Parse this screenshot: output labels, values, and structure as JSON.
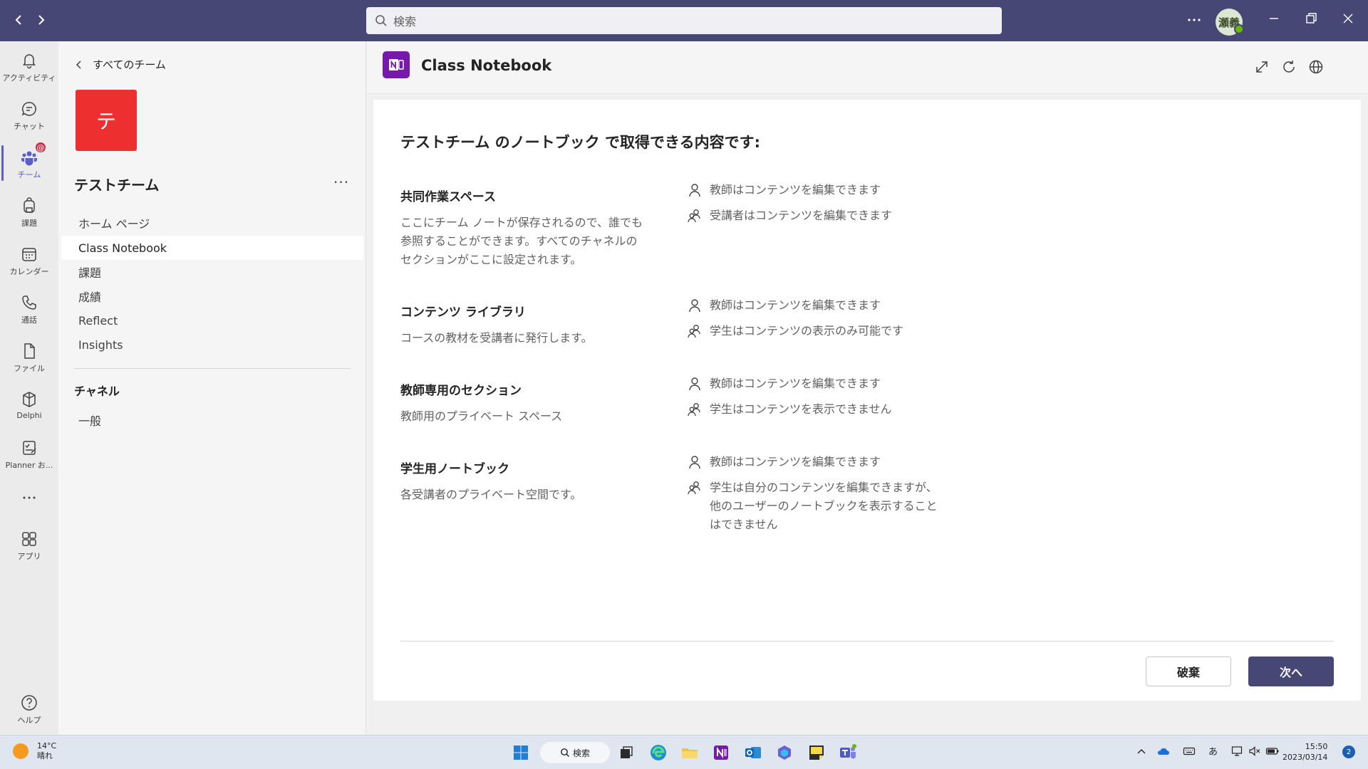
{
  "titlebar": {
    "search_placeholder": "検索",
    "avatar_initials": "瀬義"
  },
  "rail": {
    "items": [
      {
        "label": "アクティビティ",
        "icon": "bell-icon"
      },
      {
        "label": "チャット",
        "icon": "chat-icon"
      },
      {
        "label": "チーム",
        "icon": "teams-icon",
        "active": true,
        "badge": "@"
      },
      {
        "label": "課題",
        "icon": "backpack-icon"
      },
      {
        "label": "カレンダー",
        "icon": "calendar-icon"
      },
      {
        "label": "通話",
        "icon": "phone-icon"
      },
      {
        "label": "ファイル",
        "icon": "file-icon"
      },
      {
        "label": "Delphi",
        "icon": "delphi-icon"
      },
      {
        "label": "Planner お...",
        "icon": "planner-icon"
      },
      {
        "label": "...",
        "icon": "more-icon"
      },
      {
        "label": "アプリ",
        "icon": "apps-icon"
      },
      {
        "label": "ヘルプ",
        "icon": "help-icon"
      }
    ]
  },
  "teampane": {
    "back_label": "すべてのチーム",
    "team_initial": "テ",
    "team_name": "テストチーム",
    "more": "···",
    "nav": [
      "ホーム ページ",
      "Class Notebook",
      "課題",
      "成績",
      "Reflect",
      "Insights"
    ],
    "channels_heading": "チャネル",
    "channels": [
      "一般"
    ]
  },
  "main": {
    "app_title": "Class Notebook",
    "content_title": "テストチーム のノートブック で取得できる内容です:",
    "sections": [
      {
        "title": "共同作業スペース",
        "desc": "ここにチーム ノートが保存されるので、誰でも参照することができます。すべてのチャネルのセクションがここに設定されます。",
        "perms": [
          "教師はコンテンツを編集できます",
          "受講者はコンテンツを編集できます"
        ]
      },
      {
        "title": "コンテンツ ライブラリ",
        "desc": "コースの教材を受講者に発行します。",
        "perms": [
          "教師はコンテンツを編集できます",
          "学生はコンテンツの表示のみ可能です"
        ]
      },
      {
        "title": "教師専用のセクション",
        "desc": "教師用のプライベート スペース",
        "perms": [
          "教師はコンテンツを編集できます",
          "学生はコンテンツを表示できません"
        ]
      },
      {
        "title": "学生用ノートブック",
        "desc": "各受講者のプライベート空間です。",
        "perms": [
          "教師はコンテンツを編集できます",
          "学生は自分のコンテンツを編集できますが、他のユーザーのノートブックを表示することはできません"
        ]
      }
    ],
    "discard_label": "破棄",
    "next_label": "次へ"
  },
  "taskbar": {
    "weather_temp": "14°C",
    "weather_cond": "晴れ",
    "search_label": "検索",
    "ime": "あ",
    "time": "15:50",
    "date": "2023/03/14",
    "notifications": "2"
  },
  "colors": {
    "titlebar": "#464775",
    "accent": "#5b5fc7",
    "onenote": "#7719aa",
    "team_avatar": "#ee2f2f"
  }
}
